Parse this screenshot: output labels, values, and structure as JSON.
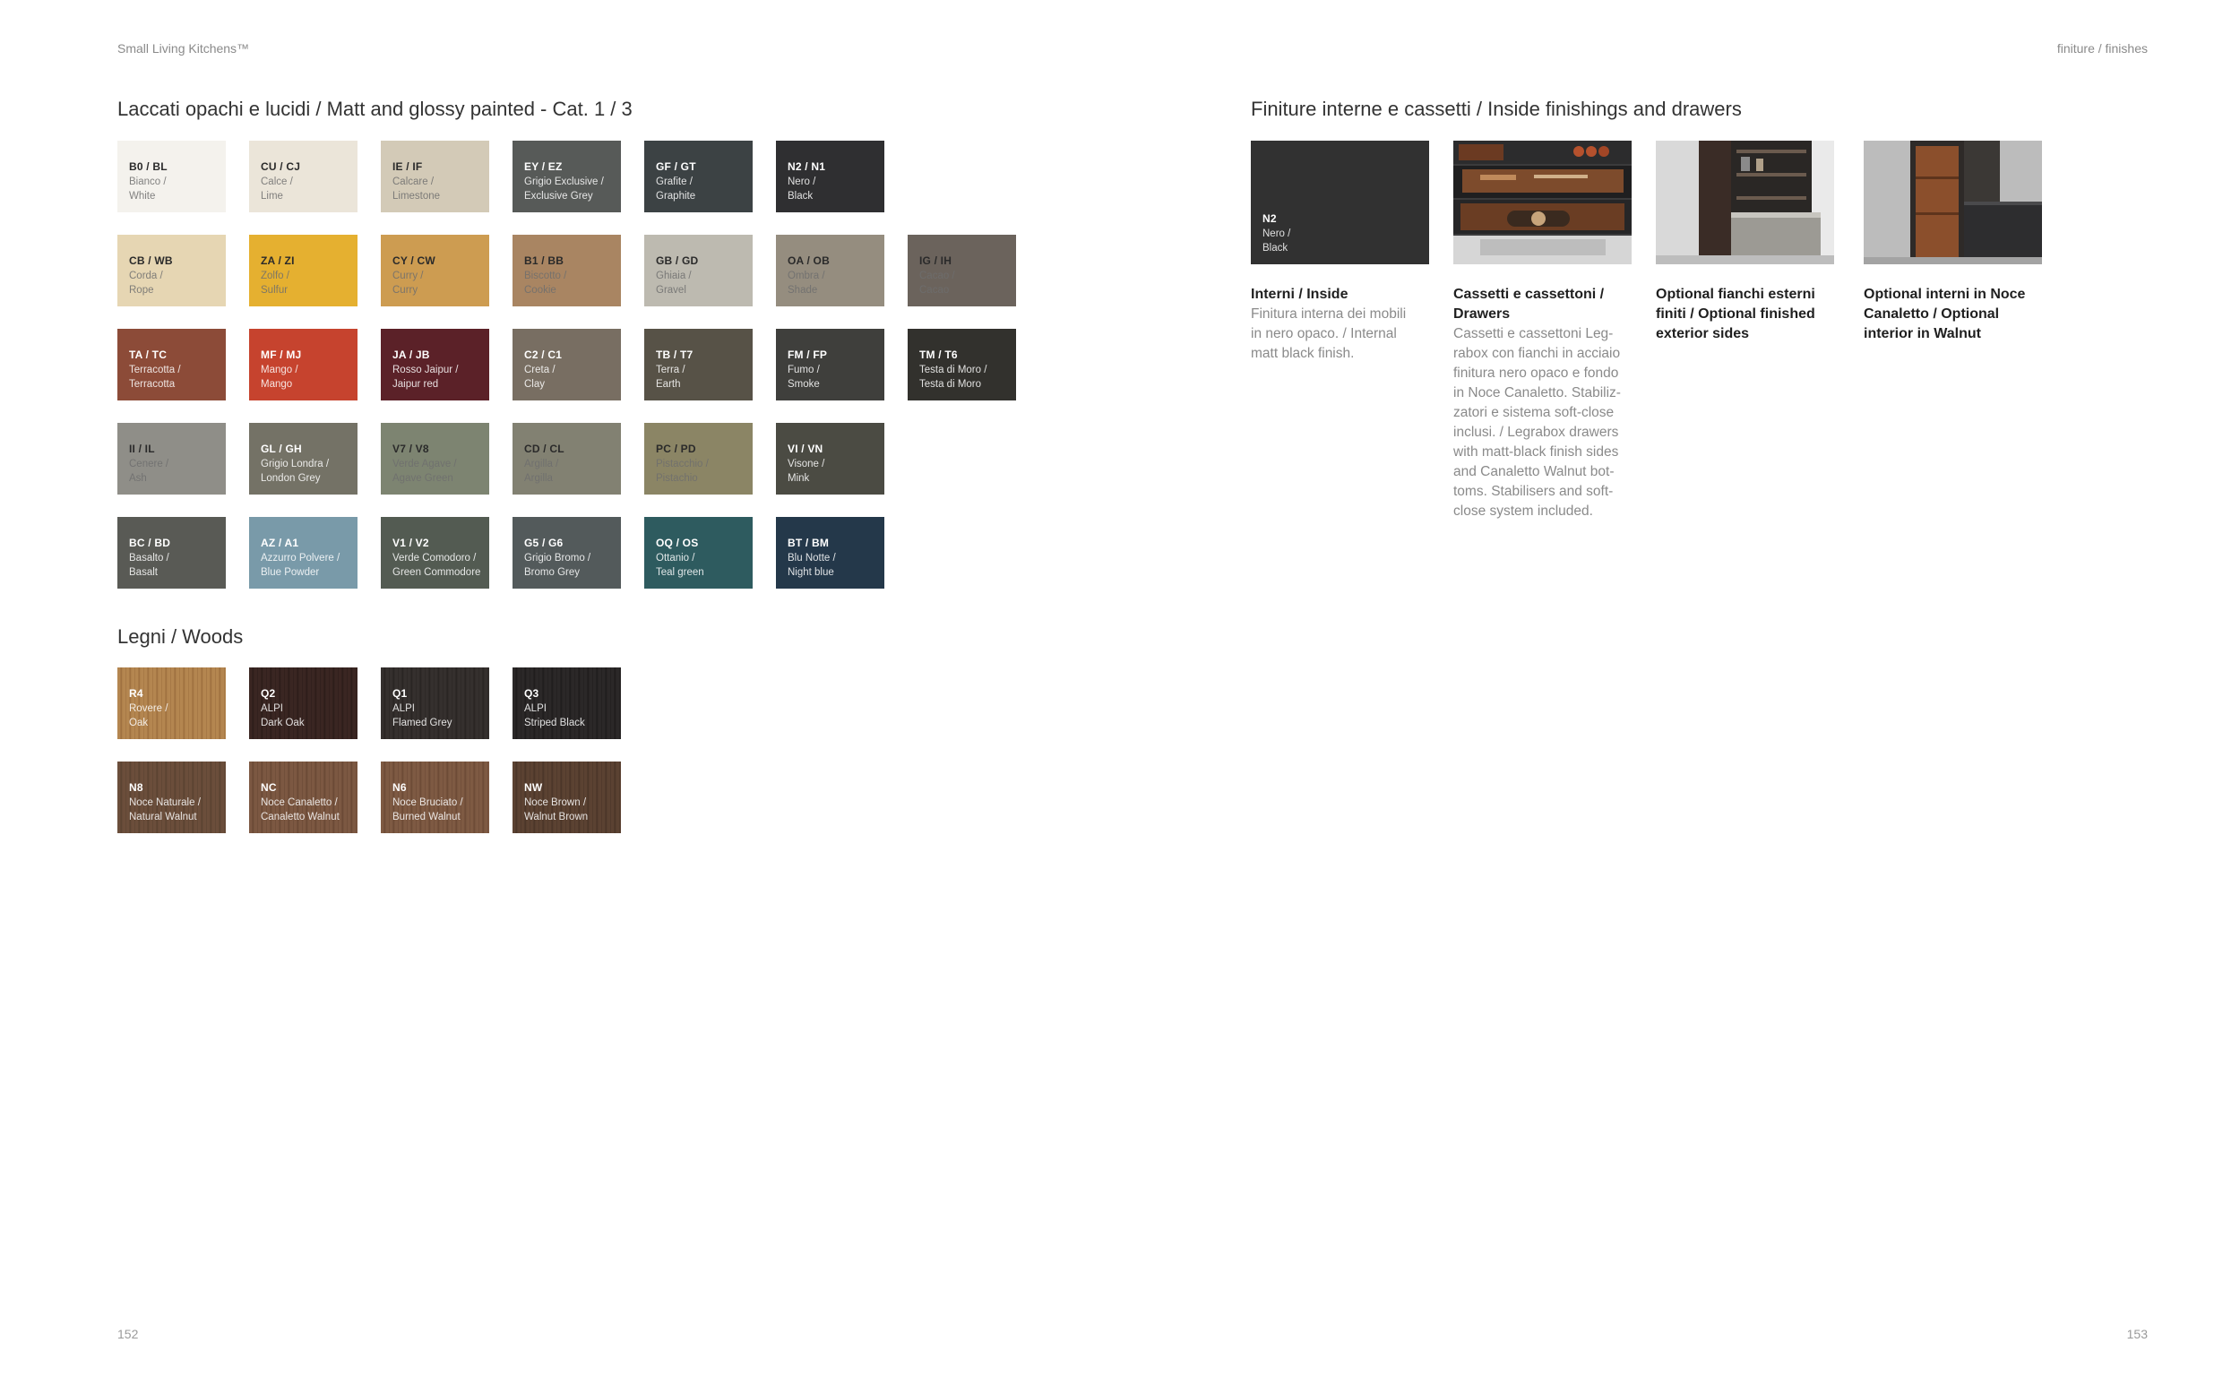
{
  "header": {
    "left": "Small Living Kitchens™",
    "right": "finiture / finishes"
  },
  "page_numbers": {
    "left": "152",
    "right": "153"
  },
  "painted": {
    "title": "Laccati opachi e lucidi / Matt and glossy painted - Cat. 1 / 3",
    "rows": [
      [
        {
          "code": "B0 / BL",
          "name1": "Bianco /",
          "name2": "White",
          "color": "#f4f2ed",
          "text": "light"
        },
        {
          "code": "CU / CJ",
          "name1": "Calce /",
          "name2": "Lime",
          "color": "#ebe5d9",
          "text": "light"
        },
        {
          "code": "IE / IF",
          "name1": "Calcare /",
          "name2": "Limestone",
          "color": "#d3cab7",
          "text": "light"
        },
        {
          "code": "EY / EZ",
          "name1": "Grigio Exclusive /",
          "name2": "Exclusive Grey",
          "color": "#575a58",
          "text": "dark"
        },
        {
          "code": "GF / GT",
          "name1": "Grafite /",
          "name2": "Graphite",
          "color": "#3c4244",
          "text": "dark"
        },
        {
          "code": "N2 / N1",
          "name1": "Nero /",
          "name2": "Black",
          "color": "#2f2f31",
          "text": "dark"
        }
      ],
      [
        {
          "code": "CB / WB",
          "name1": "Corda /",
          "name2": "Rope",
          "color": "#e6d6b3",
          "text": "light"
        },
        {
          "code": "ZA / ZI",
          "name1": "Zolfo /",
          "name2": "Sulfur",
          "color": "#e5b030",
          "text": "light"
        },
        {
          "code": "CY / CW",
          "name1": "Curry /",
          "name2": "Curry",
          "color": "#cd9c51",
          "text": "light"
        },
        {
          "code": "B1 / BB",
          "name1": "Biscotto /",
          "name2": "Cookie",
          "color": "#a98562",
          "text": "light"
        },
        {
          "code": "GB / GD",
          "name1": "Ghiaia /",
          "name2": "Gravel",
          "color": "#bdbab0",
          "text": "light"
        },
        {
          "code": "OA / OB",
          "name1": "Ombra /",
          "name2": "Shade",
          "color": "#958d7f",
          "text": "light"
        },
        {
          "code": "IG / IH",
          "name1": "Cacao /",
          "name2": "Cacao",
          "color": "#6b635c",
          "text": "light"
        }
      ],
      [
        {
          "code": "TA / TC",
          "name1": "Terracotta /",
          "name2": "Terracotta",
          "color": "#8c4b38",
          "text": "dark"
        },
        {
          "code": "MF / MJ",
          "name1": "Mango /",
          "name2": "Mango",
          "color": "#c6432e",
          "text": "dark"
        },
        {
          "code": "JA / JB",
          "name1": "Rosso Jaipur /",
          "name2": "Jaipur red",
          "color": "#5b2128",
          "text": "dark"
        },
        {
          "code": "C2 / C1",
          "name1": "Creta /",
          "name2": "Clay",
          "color": "#786e62",
          "text": "dark"
        },
        {
          "code": "TB / T7",
          "name1": "Terra /",
          "name2": "Earth",
          "color": "#575247",
          "text": "dark"
        },
        {
          "code": "FM / FP",
          "name1": "Fumo /",
          "name2": "Smoke",
          "color": "#3f3f3c",
          "text": "dark"
        },
        {
          "code": "TM / T6",
          "name1": "Testa di Moro /",
          "name2": "Testa di Moro",
          "color": "#32312d",
          "text": "dark"
        }
      ],
      [
        {
          "code": "II / IL",
          "name1": "Cenere /",
          "name2": "Ash",
          "color": "#8f8e88",
          "text": "light"
        },
        {
          "code": "GL / GH",
          "name1": "Grigio Londra /",
          "name2": "London Grey",
          "color": "#747266",
          "text": "dark"
        },
        {
          "code": "V7 / V8",
          "name1": "Verde Agave /",
          "name2": "Agave Green",
          "color": "#7d8471",
          "text": "light"
        },
        {
          "code": "CD / CL",
          "name1": "Argilla /",
          "name2": "Argilla",
          "color": "#828172",
          "text": "light"
        },
        {
          "code": "PC / PD",
          "name1": "Pistacchio /",
          "name2": "Pistachio",
          "color": "#8b8565",
          "text": "light"
        },
        {
          "code": "VI / VN",
          "name1": "Visone /",
          "name2": "Mink",
          "color": "#4b4b43",
          "text": "dark"
        }
      ],
      [
        {
          "code": "BC / BD",
          "name1": "Basalto /",
          "name2": "Basalt",
          "color": "#595a55",
          "text": "dark"
        },
        {
          "code": "AZ / A1",
          "name1": "Azzurro Polvere /",
          "name2": "Blue Powder",
          "color": "#799aa9",
          "text": "dark"
        },
        {
          "code": "V1 / V2",
          "name1": "Verde Comodoro /",
          "name2": "Green Commodore",
          "color": "#535b52",
          "text": "dark"
        },
        {
          "code": "G5 / G6",
          "name1": "Grigio Bromo /",
          "name2": "Bromo Grey",
          "color": "#535a5b",
          "text": "dark"
        },
        {
          "code": "OQ / OS",
          "name1": "Ottanio /",
          "name2": "Teal green",
          "color": "#2e5b5f",
          "text": "dark"
        },
        {
          "code": "BT / BM",
          "name1": "Blu Notte /",
          "name2": "Night blue",
          "color": "#24384a",
          "text": "dark"
        }
      ]
    ]
  },
  "woods": {
    "title": "Legni / Woods",
    "rows": [
      [
        {
          "code": "R4",
          "name1": "Rovere /",
          "name2": "Oak",
          "color": "#b48650",
          "grain": "#9a6c3c",
          "text": "dark"
        },
        {
          "code": "Q2",
          "name1": "ALPI",
          "name2": "Dark Oak",
          "color": "#3a2622",
          "grain": "#2a1b18",
          "text": "dark"
        },
        {
          "code": "Q1",
          "name1": "ALPI",
          "name2": "Flamed Grey",
          "color": "#35302e",
          "grain": "#262220",
          "text": "dark"
        },
        {
          "code": "Q3",
          "name1": "ALPI",
          "name2": "Striped Black",
          "color": "#2b2828",
          "grain": "#1c1a1a",
          "text": "dark"
        }
      ],
      [
        {
          "code": "N8",
          "name1": "Noce Naturale /",
          "name2": "Natural Walnut",
          "color": "#6b4e3b",
          "grain": "#57402f",
          "text": "dark"
        },
        {
          "code": "NC",
          "name1": "Noce Canaletto /",
          "name2": "Canaletto Walnut",
          "color": "#7c5842",
          "grain": "#664633",
          "text": "dark"
        },
        {
          "code": "N6",
          "name1": "Noce Bruciato /",
          "name2": "Burned Walnut",
          "color": "#7e5a43",
          "grain": "#684733",
          "text": "dark"
        },
        {
          "code": "NW",
          "name1": "Noce Brown /",
          "name2": "Walnut Brown",
          "color": "#5b4232",
          "grain": "#473326",
          "text": "dark"
        }
      ]
    ]
  },
  "inside": {
    "title": "Finiture interne e cassetti / Inside finishings and drawers",
    "swatch": {
      "code": "N2",
      "name1": "Nero /",
      "name2": "Black",
      "color": "#313131"
    },
    "captions": [
      {
        "title": "Interni / Inside",
        "body": "Finitura interna dei mobili in nero opaco. / Internal matt black finish."
      },
      {
        "title": "Cassetti e cassettoni / Drawers",
        "body": "Cassetti e cassettoni Leg-rabox con fianchi in acciaio finitura nero opaco e fondo in Noce Canaletto. Stabiliz-zatori e sistema soft-close inclusi. / Legrabox drawers with matt-black finish sides and Canaletto Walnut bot-toms. Stabilisers and soft-close system included."
      },
      {
        "title": "Optional fianchi esterni finiti / Optional finished exterior sides",
        "body": ""
      },
      {
        "title": "Optional interni in Noce Canaletto / Optional interior in Walnut",
        "body": ""
      }
    ]
  }
}
